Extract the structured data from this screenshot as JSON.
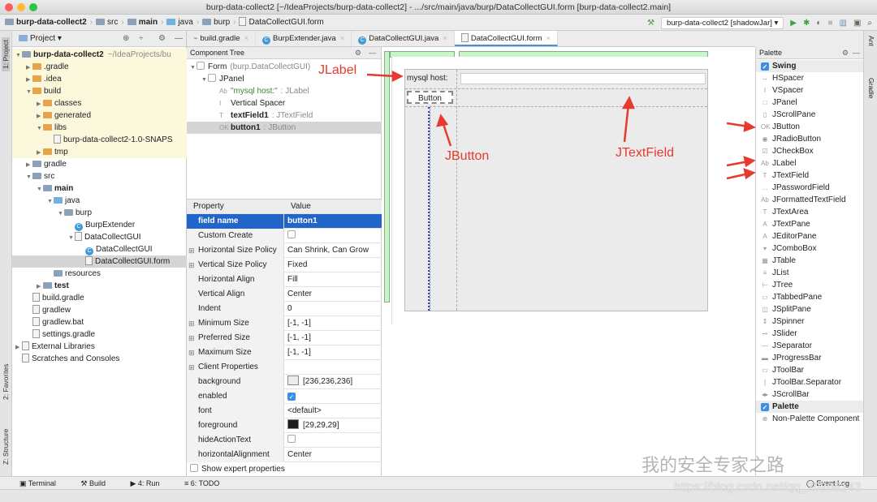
{
  "window": {
    "title": "burp-data-collect2 [~/IdeaProjects/burp-data-collect2] - .../src/main/java/burp/DataCollectGUI.form [burp-data-collect2.main]"
  },
  "breadcrumb": [
    "burp-data-collect2",
    "src",
    "main",
    "java",
    "burp",
    "DataCollectGUI.form"
  ],
  "run": {
    "config": "burp-data-collect2 [shadowJar]"
  },
  "left_strip": {
    "project": "1: Project",
    "favorites": "2: Favorites",
    "structure": "Z: Structure"
  },
  "right_strip": {
    "ant": "Ant",
    "gradle": "Gradle"
  },
  "project": {
    "title": "Project",
    "items": [
      {
        "label": "burp-data-collect2",
        "extra": "~/IdeaProjects/bu",
        "indent": 0,
        "icon": "module-folder",
        "bold": true,
        "yellow": true,
        "open": true
      },
      {
        "label": ".gradle",
        "indent": 1,
        "icon": "folder-orange",
        "yellow": true,
        "open": false
      },
      {
        "label": ".idea",
        "indent": 1,
        "icon": "folder-orange",
        "yellow": true,
        "open": false
      },
      {
        "label": "build",
        "indent": 1,
        "icon": "folder-orange",
        "yellow": true,
        "open": true
      },
      {
        "label": "classes",
        "indent": 2,
        "icon": "folder-orange",
        "yellow": true,
        "open": false
      },
      {
        "label": "generated",
        "indent": 2,
        "icon": "folder-orange",
        "yellow": true,
        "open": false
      },
      {
        "label": "libs",
        "indent": 2,
        "icon": "folder-orange",
        "yellow": true,
        "open": true
      },
      {
        "label": "burp-data-collect2-1.0-SNAPS",
        "indent": 3,
        "icon": "jar",
        "yellow": true
      },
      {
        "label": "tmp",
        "indent": 2,
        "icon": "folder-orange",
        "yellow": true,
        "open": false
      },
      {
        "label": "gradle",
        "indent": 1,
        "icon": "folder",
        "open": false
      },
      {
        "label": "src",
        "indent": 1,
        "icon": "folder",
        "open": true
      },
      {
        "label": "main",
        "indent": 2,
        "icon": "module-folder",
        "bold": true,
        "open": true
      },
      {
        "label": "java",
        "indent": 3,
        "icon": "folder-blue",
        "open": true
      },
      {
        "label": "burp",
        "indent": 4,
        "icon": "folder",
        "open": true
      },
      {
        "label": "BurpExtender",
        "indent": 5,
        "icon": "class"
      },
      {
        "label": "DataCollectGUI",
        "indent": 5,
        "icon": "form",
        "open": true
      },
      {
        "label": "DataCollectGUI",
        "indent": 6,
        "icon": "class"
      },
      {
        "label": "DataCollectGUI.form",
        "indent": 6,
        "icon": "form",
        "selected": true
      },
      {
        "label": "resources",
        "indent": 3,
        "icon": "folder"
      },
      {
        "label": "test",
        "indent": 2,
        "icon": "folder",
        "bold": true,
        "open": false
      },
      {
        "label": "build.gradle",
        "indent": 1,
        "icon": "gradle"
      },
      {
        "label": "gradlew",
        "indent": 1,
        "icon": "file"
      },
      {
        "label": "gradlew.bat",
        "indent": 1,
        "icon": "file"
      },
      {
        "label": "settings.gradle",
        "indent": 1,
        "icon": "gradle"
      },
      {
        "label": "External Libraries",
        "indent": 0,
        "icon": "library",
        "open": false
      },
      {
        "label": "Scratches and Consoles",
        "indent": 0,
        "icon": "scratches"
      }
    ]
  },
  "tabs": [
    {
      "label": "build.gradle"
    },
    {
      "label": "BurpExtender.java"
    },
    {
      "label": "DataCollectGUI.java"
    },
    {
      "label": "DataCollectGUI.form",
      "active": true
    }
  ],
  "component_tree": {
    "title": "Component Tree",
    "items": [
      {
        "name": "Form",
        "type": "(burp.DataCollectGUI)",
        "indent": 0
      },
      {
        "name": "JPanel",
        "type": "",
        "indent": 1
      },
      {
        "name": "\"mysql host:\"",
        "type": ": JLabel",
        "indent": 2,
        "green": true,
        "icon": "Ab"
      },
      {
        "name": "Vertical Spacer",
        "type": "",
        "indent": 2,
        "icon": "I"
      },
      {
        "name": "textField1",
        "type": ": JTextField",
        "indent": 2,
        "bold": true,
        "icon": "T"
      },
      {
        "name": "button1",
        "type": ": JButton",
        "indent": 2,
        "bold": true,
        "icon": "OK",
        "selected": true
      }
    ]
  },
  "properties": {
    "col_property": "Property",
    "col_value": "Value",
    "rows": [
      {
        "k": "field name",
        "v": "button1",
        "selected": true
      },
      {
        "k": "Custom Create",
        "v": "",
        "check": false
      },
      {
        "k": "Horizontal Size Policy",
        "v": "Can Shrink, Can Grow",
        "plus": true
      },
      {
        "k": "Vertical Size Policy",
        "v": "Fixed",
        "plus": true
      },
      {
        "k": "Horizontal Align",
        "v": "Fill"
      },
      {
        "k": "Vertical Align",
        "v": "Center"
      },
      {
        "k": "Indent",
        "v": "0"
      },
      {
        "k": "Minimum Size",
        "v": "[-1, -1]",
        "plus": true
      },
      {
        "k": "Preferred Size",
        "v": "[-1, -1]",
        "plus": true
      },
      {
        "k": "Maximum Size",
        "v": "[-1, -1]",
        "plus": true
      },
      {
        "k": "Client Properties",
        "v": "",
        "plus": true
      },
      {
        "k": "background",
        "v": "[236,236,236]",
        "swatch": "#ececec"
      },
      {
        "k": "enabled",
        "v": "",
        "check": true
      },
      {
        "k": "font",
        "v": "<default>"
      },
      {
        "k": "foreground",
        "v": "[29,29,29]",
        "swatch": "#1d1d1d"
      },
      {
        "k": "hideActionText",
        "v": "",
        "check": false
      },
      {
        "k": "horizontalAlignment",
        "v": "Center"
      }
    ],
    "expert": "Show expert properties"
  },
  "design": {
    "label_text": "mysql host:",
    "button_text": "Button",
    "textfield_value": ""
  },
  "annotations": {
    "jlabel": "JLabel",
    "jbutton": "JButton",
    "jtextfield": "JTextField"
  },
  "palette": {
    "title": "Palette",
    "groups": [
      {
        "label": "Swing",
        "checked": true
      }
    ],
    "items": [
      {
        "label": "HSpacer",
        "icon": "↔"
      },
      {
        "label": "VSpacer",
        "icon": "I"
      },
      {
        "label": "JPanel",
        "icon": "□"
      },
      {
        "label": "JScrollPane",
        "icon": "▯"
      },
      {
        "label": "JButton",
        "icon": "OK"
      },
      {
        "label": "JRadioButton",
        "icon": "◉"
      },
      {
        "label": "JCheckBox",
        "icon": "☑"
      },
      {
        "label": "JLabel",
        "icon": "Ab"
      },
      {
        "label": "JTextField",
        "icon": "T"
      },
      {
        "label": "JPasswordField",
        "icon": "…"
      },
      {
        "label": "JFormattedTextField",
        "icon": "Ab"
      },
      {
        "label": "JTextArea",
        "icon": "T"
      },
      {
        "label": "JTextPane",
        "icon": "A"
      },
      {
        "label": "JEditorPane",
        "icon": "A"
      },
      {
        "label": "JComboBox",
        "icon": "▾"
      },
      {
        "label": "JTable",
        "icon": "▦"
      },
      {
        "label": "JList",
        "icon": "≡"
      },
      {
        "label": "JTree",
        "icon": "⊢"
      },
      {
        "label": "JTabbedPane",
        "icon": "▭"
      },
      {
        "label": "JSplitPane",
        "icon": "◫"
      },
      {
        "label": "JSpinner",
        "icon": "⇕"
      },
      {
        "label": "JSlider",
        "icon": "⊸"
      },
      {
        "label": "JSeparator",
        "icon": "—"
      },
      {
        "label": "JProgressBar",
        "icon": "▬"
      },
      {
        "label": "JToolBar",
        "icon": "▭"
      },
      {
        "label": "JToolBar.Separator",
        "icon": "|"
      },
      {
        "label": "JScrollBar",
        "icon": "◂▸"
      }
    ],
    "group2": "Palette",
    "non_palette": "Non-Palette Component"
  },
  "bottom": {
    "terminal": "Terminal",
    "build": "Build",
    "run": "4: Run",
    "todo": "6: TODO",
    "event_log": "Event Log"
  },
  "watermark": {
    "name": "我的安全专家之路",
    "url": "https://blog.csdn.net/qq_20208143"
  }
}
